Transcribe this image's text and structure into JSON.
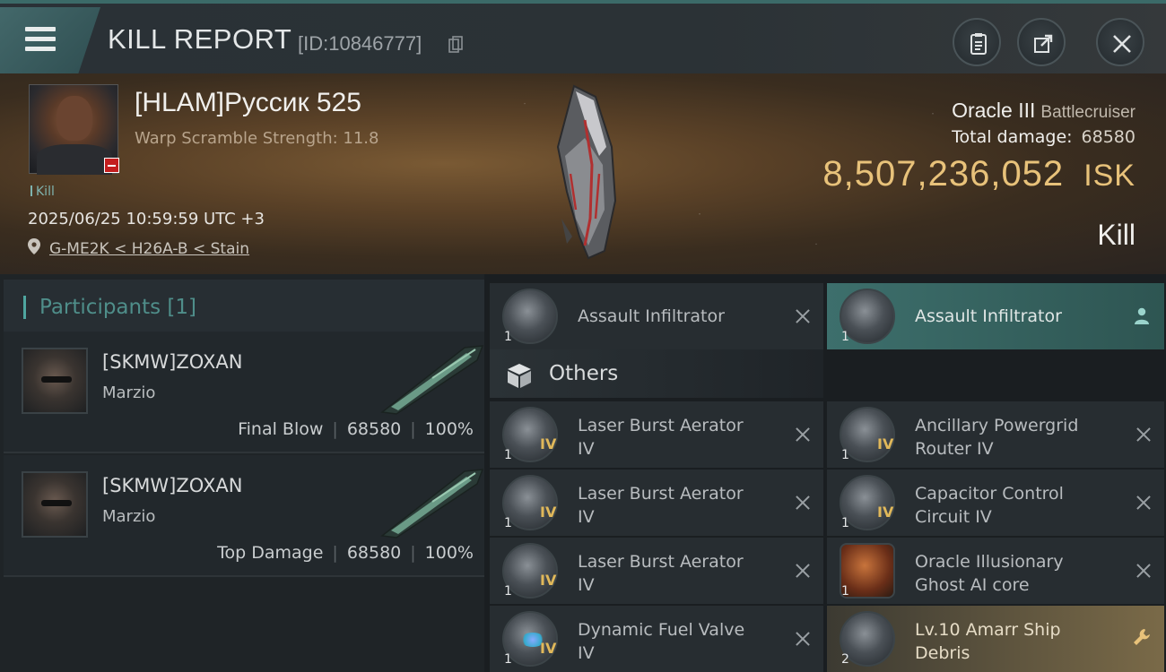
{
  "header": {
    "title": "KILL REPORT",
    "report_id": "[ID:10846777]",
    "icons": [
      "menu-icon",
      "copy-icon",
      "clipboard-icon",
      "share-icon",
      "close-icon"
    ]
  },
  "victim": {
    "name": "[HLAM]Руссик 525",
    "warp_scramble": "Warp Scramble Strength: 11.8",
    "tag": "Kill",
    "datetime": "2025/06/25 10:59:59 UTC +3",
    "location": "G-ME2K < H26A-B < Stain",
    "ship": "Oracle III",
    "ship_class": "Battlecruiser",
    "total_damage_label": "Total damage:",
    "total_damage": "68580",
    "isk_value": "8,507,236,052",
    "isk_unit": "ISK",
    "result": "Kill"
  },
  "participants": {
    "title": "Participants",
    "count": "[1]",
    "rows": [
      {
        "name": "[SKMW]ZOXAN",
        "ship": "Marzio",
        "role": "Final Blow",
        "damage": "68580",
        "percent": "100%"
      },
      {
        "name": "[SKMW]ZOXAN",
        "ship": "Marzio",
        "role": "Top Damage",
        "damage": "68580",
        "percent": "100%"
      }
    ]
  },
  "items": {
    "top": [
      {
        "name": "Assault Infiltrator",
        "qty": "1",
        "status": "destroyed"
      },
      {
        "name": "Assault Infiltrator",
        "qty": "1",
        "status": "ally"
      }
    ],
    "others_title": "Others",
    "left": [
      {
        "name1": "Laser Burst Aerator",
        "name2": "IV",
        "qty": "1",
        "level": "IV"
      },
      {
        "name1": "Laser Burst Aerator",
        "name2": "IV",
        "qty": "1",
        "level": "IV"
      },
      {
        "name1": "Laser Burst Aerator",
        "name2": "IV",
        "qty": "1",
        "level": "IV"
      },
      {
        "name1": "Dynamic Fuel Valve",
        "name2": "IV",
        "qty": "1",
        "level": "IV"
      }
    ],
    "right": [
      {
        "name1": "Ancillary Powergrid",
        "name2": "Router IV",
        "qty": "1",
        "level": "IV"
      },
      {
        "name1": "Capacitor Control",
        "name2": "Circuit IV",
        "qty": "1",
        "level": "IV"
      },
      {
        "name1": "Oracle Illusionary",
        "name2": "Ghost AI core",
        "qty": "1",
        "level": ""
      },
      {
        "name1": "Lv.10 Amarr Ship",
        "name2": "Debris",
        "qty": "2",
        "level": ""
      }
    ]
  },
  "colors": {
    "accent": "#4fa6a0",
    "isk": "#e8c27a",
    "ally_highlight": "#3d6f6c",
    "loot_highlight": "#7a6a48",
    "level_badge": "#e0b85a"
  }
}
